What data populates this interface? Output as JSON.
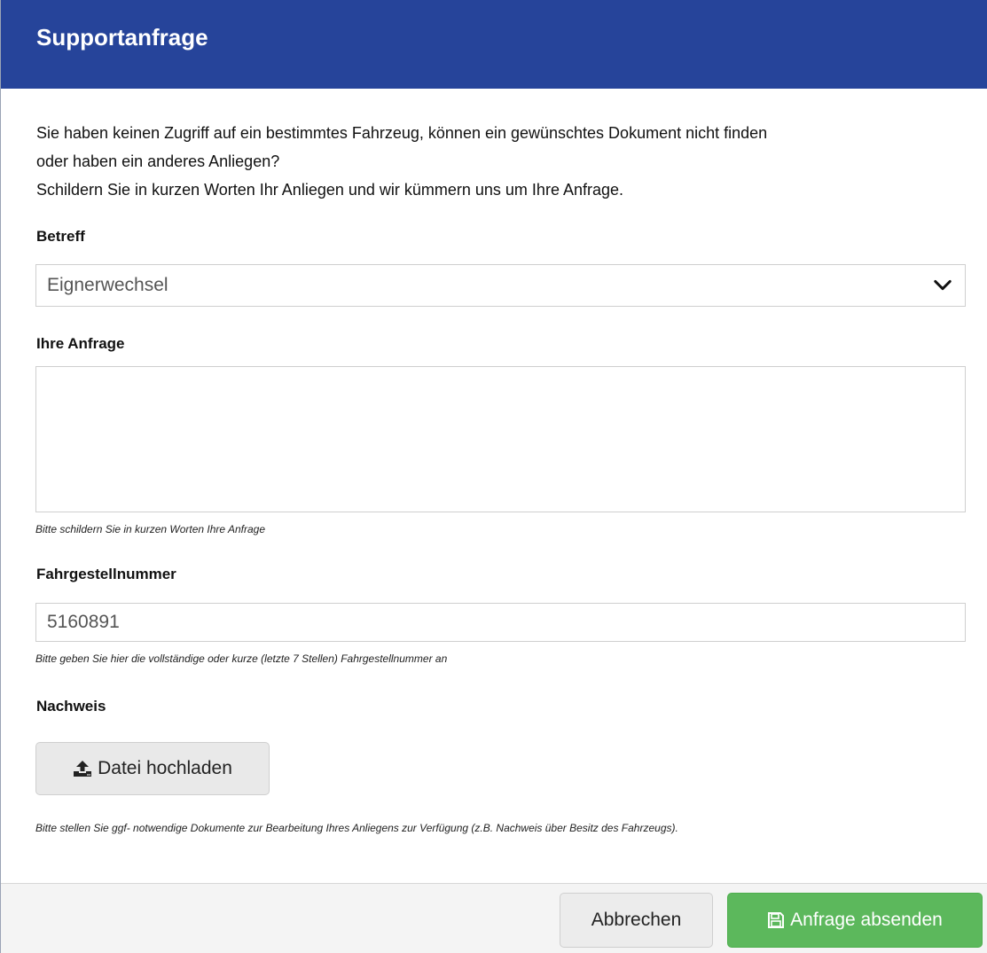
{
  "modal": {
    "title": "Supportanfrage",
    "intro_line1": "Sie haben keinen Zugriff auf ein bestimmtes Fahrzeug, können ein gewünschtes Dokument nicht finden",
    "intro_line2": "oder haben ein anderes Anliegen?",
    "intro_line3": "Schildern Sie in kurzen Worten Ihr Anliegen und wir kümmern uns um Ihre Anfrage."
  },
  "form": {
    "subject": {
      "label": "Betreff",
      "selected": "Eignerwechsel"
    },
    "request": {
      "label": "Ihre Anfrage",
      "value": "",
      "help": "Bitte schildern Sie in kurzen Worten Ihre Anfrage"
    },
    "vin": {
      "label": "Fahrgestellnummer",
      "value": "5160891",
      "help": "Bitte geben Sie hier die vollständige oder kurze (letzte 7 Stellen) Fahrgestellnummer an"
    },
    "proof": {
      "label": "Nachweis",
      "upload_label": "Datei hochladen",
      "help": "Bitte stellen Sie ggf- notwendige Dokumente zur Bearbeitung Ihres Anliegens zur Verfügung (z.B. Nachweis über Besitz des Fahrzeugs)."
    }
  },
  "footer": {
    "cancel_label": "Abbrechen",
    "submit_label": "Anfrage absenden"
  },
  "colors": {
    "header_bg": "#26449a",
    "submit_bg": "#5cb85c"
  },
  "icons": {
    "select": "chevron-down-icon",
    "upload": "upload-icon",
    "submit": "floppy-disk-icon"
  }
}
